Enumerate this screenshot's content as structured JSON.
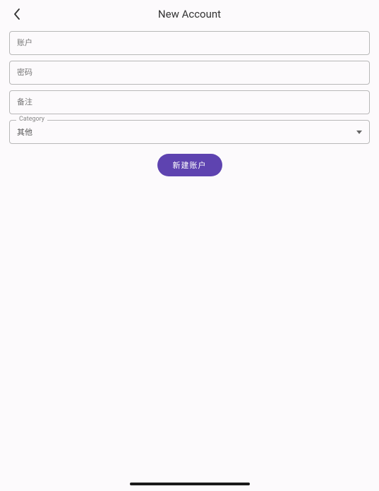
{
  "header": {
    "title": "New Account"
  },
  "form": {
    "account_placeholder": "账户",
    "password_placeholder": "密码",
    "note_placeholder": "备注",
    "category_label": "Category",
    "category_value": "其他",
    "submit_label": "新建账户"
  }
}
